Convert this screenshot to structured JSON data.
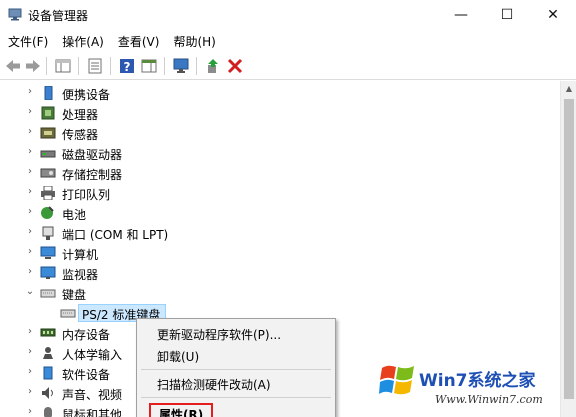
{
  "window": {
    "title": "设备管理器",
    "controls": {
      "minimize": "—",
      "maximize": "☐",
      "close": "✕"
    }
  },
  "menu": [
    "文件(F)",
    "操作(A)",
    "查看(V)",
    "帮助(H)"
  ],
  "toolbar": [
    "back-icon",
    "forward-icon",
    "show-hide-console-tree-icon",
    "properties-icon",
    "help-icon",
    "action-pane-icon",
    "monitor-icon",
    "update-driver-icon",
    "uninstall-icon"
  ],
  "tree": {
    "items": [
      {
        "label": "便携设备",
        "icon": "portable-device-icon",
        "expanded": false
      },
      {
        "label": "处理器",
        "icon": "processor-icon",
        "expanded": false
      },
      {
        "label": "传感器",
        "icon": "sensor-icon",
        "expanded": false
      },
      {
        "label": "磁盘驱动器",
        "icon": "disk-drive-icon",
        "expanded": false
      },
      {
        "label": "存储控制器",
        "icon": "storage-controller-icon",
        "expanded": false
      },
      {
        "label": "打印队列",
        "icon": "printer-icon",
        "expanded": false
      },
      {
        "label": "电池",
        "icon": "battery-icon",
        "expanded": false
      },
      {
        "label": "端口 (COM 和 LPT)",
        "icon": "port-icon",
        "expanded": false
      },
      {
        "label": "计算机",
        "icon": "computer-icon",
        "expanded": false
      },
      {
        "label": "监视器",
        "icon": "monitor-icon",
        "expanded": false
      },
      {
        "label": "键盘",
        "icon": "keyboard-icon",
        "expanded": true
      },
      {
        "label": "PS/2 标准键盘",
        "icon": "keyboard-icon",
        "child": true,
        "selected": true
      },
      {
        "label": "内存设备",
        "icon": "memory-icon",
        "expanded": false
      },
      {
        "label": "人体学输入",
        "icon": "hid-icon",
        "expanded": false
      },
      {
        "label": "软件设备",
        "icon": "software-device-icon",
        "expanded": false
      },
      {
        "label": "声音、视频",
        "icon": "audio-icon",
        "expanded": false
      },
      {
        "label": "鼠标和其他",
        "icon": "mouse-icon",
        "expanded": false
      }
    ]
  },
  "context_menu": {
    "update": "更新驱动程序软件(P)...",
    "uninstall": "卸载(U)",
    "scan": "扫描检测硬件改动(A)",
    "properties": "属性(R)"
  },
  "watermark": {
    "brand": "Win7系统之家",
    "url": "Www.Winwin7.com"
  },
  "colors": {
    "selection": "#cce8ff",
    "highlight_box": "#e21e1e",
    "brand": "#1e4fb5"
  }
}
